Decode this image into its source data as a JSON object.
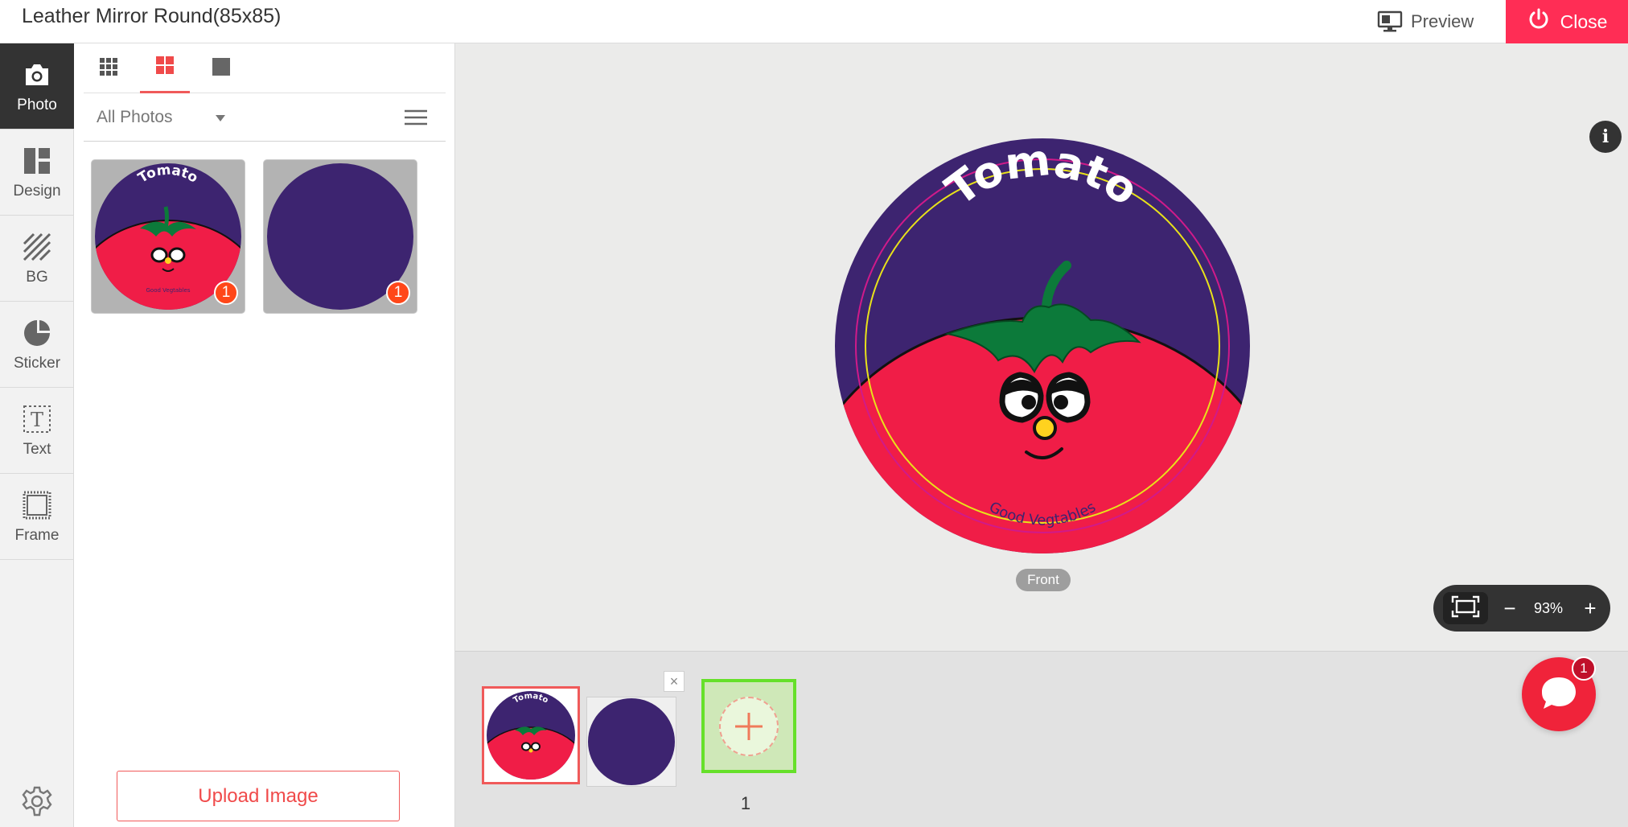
{
  "app": {
    "title": "Leather Mirror Round(85x85)",
    "preview_label": "Preview",
    "close_label": "Close"
  },
  "sidebar": {
    "items": [
      {
        "label": "Photo",
        "icon": "camera-icon",
        "active": true
      },
      {
        "label": "Design",
        "icon": "layout-icon",
        "active": false
      },
      {
        "label": "BG",
        "icon": "hatch-icon",
        "active": false
      },
      {
        "label": "Sticker",
        "icon": "sticker-icon",
        "active": false
      },
      {
        "label": "Text",
        "icon": "text-icon",
        "active": false
      },
      {
        "label": "Frame",
        "icon": "frame-icon",
        "active": false
      }
    ],
    "settings_icon": "gear-icon"
  },
  "photo_panel": {
    "view_tabs": [
      {
        "icon": "grid-small-icon",
        "active": false
      },
      {
        "icon": "grid-medium-icon",
        "active": true
      },
      {
        "icon": "grid-large-icon",
        "active": false
      }
    ],
    "filter": {
      "selected": "All Photos"
    },
    "photos": [
      {
        "name": "tomato-design",
        "title_text": "Tomato",
        "footer_text": "Good Vegtables",
        "usage_count": "1"
      },
      {
        "name": "purple-circle",
        "usage_count": "1"
      }
    ],
    "upload_label": "Upload Image"
  },
  "canvas": {
    "design": {
      "title_text": "Tomato",
      "footer_text": "Good Vegtables",
      "colors": {
        "background": "#3d2470",
        "tomato": "#f01d47",
        "leaf": "#0c7a3a",
        "nose": "#ffd21f",
        "safe_line": "#e8e21a",
        "cut_line": "#d01a8a"
      }
    },
    "side_label": "Front",
    "zoom": {
      "value": "93%",
      "minus": "−",
      "plus": "+"
    }
  },
  "page_strip": {
    "pages": [
      {
        "name": "page-1-front",
        "selected": true
      },
      {
        "name": "page-2-back",
        "selected": false
      }
    ],
    "remove_label": "×",
    "add_icon": "plus-icon",
    "page_number": "1"
  },
  "chat": {
    "badge": "1"
  },
  "colors": {
    "accent": "#ff2d55",
    "rail_active": "#333333",
    "add_page_border": "#66e02a"
  }
}
